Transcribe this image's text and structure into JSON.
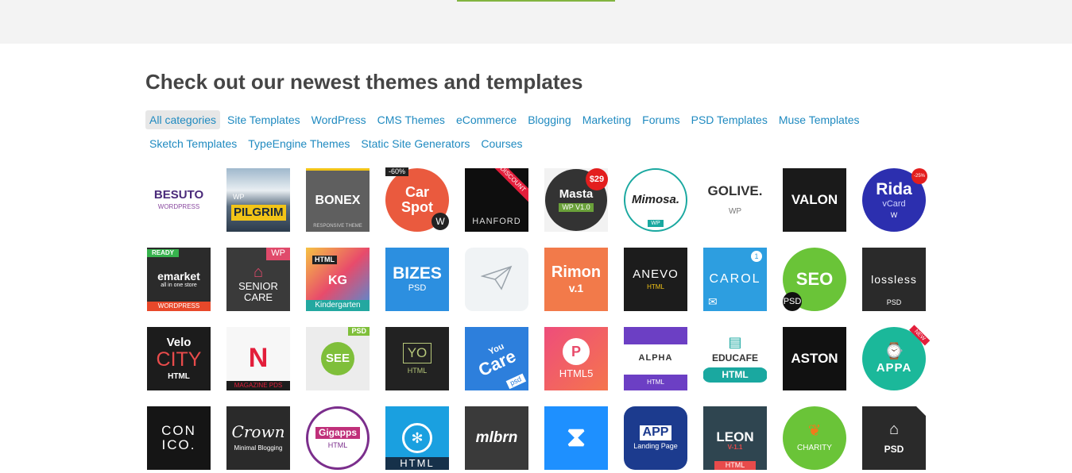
{
  "heading": "Check out our newest themes and templates",
  "categories_row1": [
    "All categories",
    "Site Templates",
    "WordPress",
    "CMS Themes",
    "eCommerce",
    "Blogging",
    "Marketing",
    "Forums",
    "PSD Templates",
    "Muse Templates"
  ],
  "categories_row2": [
    "Sketch Templates",
    "TypeEngine Themes",
    "Static Site Generators",
    "Courses"
  ],
  "tiles": [
    {
      "line1": "BESUTO",
      "line2": "WORDPRESS"
    },
    {
      "tag": "WP",
      "line1": "PILGRIM"
    },
    {
      "line1": "BONEX",
      "line2": "RESPONSIVE THEME"
    },
    {
      "badge": "-60%",
      "line1": "Car",
      "line2": "Spot",
      "corner": "W"
    },
    {
      "ribbon": "DISCOUNT",
      "line1": "HANFORD"
    },
    {
      "badge": "$29",
      "line1": "Masta",
      "line2": "WP V1.0"
    },
    {
      "line1": "Mimosa.",
      "line2": "WP"
    },
    {
      "line1": "GOLIVE.",
      "line2": "WP"
    },
    {
      "line1": "VALON"
    },
    {
      "badge": "-25%",
      "line1": "Rida",
      "line2": "vCard",
      "corner": "W"
    },
    {
      "badge": "READY",
      "line1": "emarket",
      "line2": "all in one store",
      "line3": "WORDPRESS"
    },
    {
      "tag": "WP",
      "line1": "SENIOR",
      "line2": "CARE"
    },
    {
      "tag": "HTML",
      "line1": "KG",
      "line2": "Kindergarten"
    },
    {
      "line1": "BIZES",
      "line2": "PSD"
    },
    {
      "line1": ""
    },
    {
      "line1": "Rimon",
      "line2": "v.1"
    },
    {
      "line1": "ANEVO",
      "line2": "HTML"
    },
    {
      "badge": "1",
      "line1": "CAROL"
    },
    {
      "line1": "SEO",
      "line2": "PSD"
    },
    {
      "line1": "lossless",
      "line2": "PSD"
    },
    {
      "line1": "Velo",
      "line2": "CITY",
      "line3": "HTML"
    },
    {
      "line1": "N",
      "line2": "MAGAZINE PDS"
    },
    {
      "tag": "PSD",
      "line1": "SEE"
    },
    {
      "line1": "YO",
      "line2": "HTML"
    },
    {
      "line1": "You",
      "line2": "Care",
      "line3": "psd"
    },
    {
      "line1": "HTML5"
    },
    {
      "line1": "ALPHA",
      "line2": "HTML"
    },
    {
      "line1": "EDUCAFE",
      "line2": "HTML"
    },
    {
      "line1": "ASTON"
    },
    {
      "ribbon": "NEW",
      "line1": "APPA"
    },
    {
      "line1": "CON",
      "line2": "ICO."
    },
    {
      "line1": "Crown",
      "line2": "Minimal Blogging"
    },
    {
      "line1": "Gigapps",
      "line2": "HTML"
    },
    {
      "line1": "HTML"
    },
    {
      "line1": "mlbrn"
    },
    {
      "line1": ""
    },
    {
      "line1": "APP",
      "line2": "Landing Page"
    },
    {
      "line1": "LEON",
      "line2": "V-1.1",
      "line3": "HTML"
    },
    {
      "line1": "CHARITY"
    },
    {
      "line1": "PSD"
    }
  ],
  "colors": {
    "link": "#1f8ac0",
    "heading": "#454545",
    "accent_green": "#82b440",
    "top_band": "#f3f3f3"
  },
  "icons": [
    "paper-plane-icon",
    "store-icon",
    "book-icon",
    "house-heart-icon",
    "aperture-icon",
    "hourglass-icon",
    "watch-icon",
    "hand-drop-icon",
    "envelope-icon",
    "wordpress-icon"
  ]
}
